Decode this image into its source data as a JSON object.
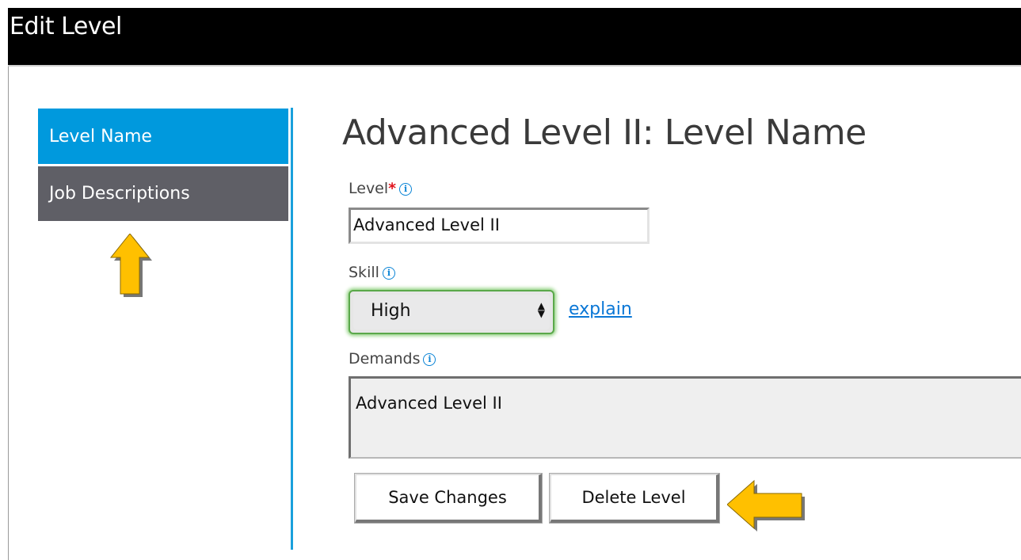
{
  "window": {
    "title": "Edit Level"
  },
  "sidebar": {
    "items": [
      {
        "label": "Level Name",
        "active": true
      },
      {
        "label": "Job Descriptions",
        "active": false
      }
    ]
  },
  "main": {
    "page_title": "Advanced Level II: Level Name",
    "level": {
      "label": "Level",
      "required_mark": "*",
      "info_icon": "i",
      "value": "Advanced Level II"
    },
    "skill": {
      "label": "Skill",
      "info_icon": "i",
      "selected": "High",
      "explain_link": "explain"
    },
    "demands": {
      "label": "Demands",
      "info_icon": "i",
      "value": "Advanced Level II"
    },
    "buttons": {
      "save": "Save Changes",
      "delete": "Delete Level"
    }
  },
  "annotations": {
    "arrow_color": "#ffc000",
    "arrows": [
      "up-arrow-under-job-descriptions",
      "left-arrow-beside-delete-level"
    ]
  },
  "colors": {
    "titlebar": "#000000",
    "sidebar_active": "#0099dd",
    "sidebar_inactive": "#5f5f66",
    "link": "#0a77d6",
    "required": "#e0141e",
    "focus_glow": "#8fd17e"
  }
}
